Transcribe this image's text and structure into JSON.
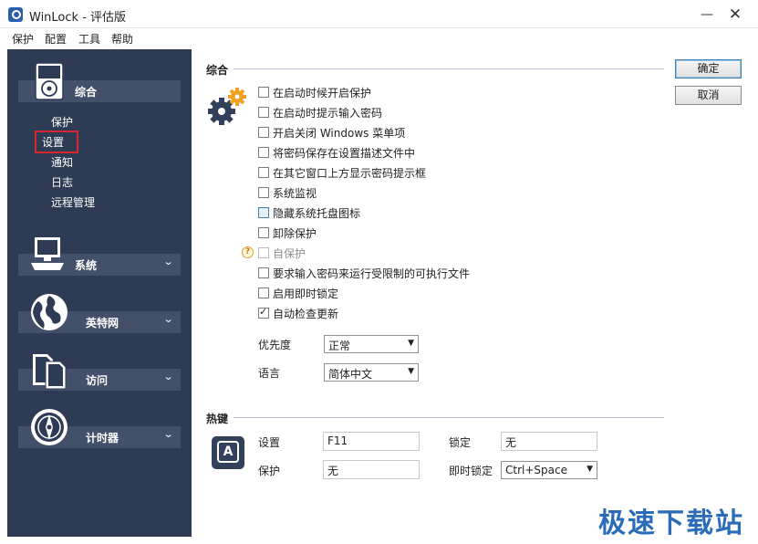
{
  "window": {
    "title": "WinLock - 评估版",
    "minimize": "—",
    "close": "✕"
  },
  "menu": [
    "保护",
    "配置",
    "工具",
    "帮助"
  ],
  "sidebar": {
    "categories": [
      {
        "label": "综合",
        "icon": "ipod-icon",
        "expanded": true,
        "items": [
          "保护",
          "设置",
          "通知",
          "日志",
          "远程管理"
        ],
        "selected": "设置"
      },
      {
        "label": "系统",
        "icon": "computer-icon",
        "chevron": "⌄"
      },
      {
        "label": "英特网",
        "icon": "globe-icon",
        "chevron": "⌄"
      },
      {
        "label": "访问",
        "icon": "documents-icon",
        "chevron": "⌄"
      },
      {
        "label": "计时器",
        "icon": "compass-icon",
        "chevron": "⌄"
      }
    ]
  },
  "general": {
    "title": "综合",
    "options": [
      {
        "label": "在启动时候开启保护",
        "checked": false
      },
      {
        "label": "在启动时提示输入密码",
        "checked": false
      },
      {
        "label": "开启关闭 Windows 菜单项",
        "checked": false
      },
      {
        "label": "将密码保存在设置描述文件中",
        "checked": false
      },
      {
        "label": "在其它窗口上方显示密码提示框",
        "checked": false
      },
      {
        "label": "系统监视",
        "checked": false
      },
      {
        "label": "隐藏系统托盘图标",
        "checked": false,
        "highlighted": true
      },
      {
        "label": "卸除保护",
        "checked": false
      },
      {
        "label": "自保护",
        "checked": false,
        "disabled": true
      },
      {
        "label": "要求输入密码来运行受限制的可执行文件",
        "checked": false
      },
      {
        "label": "启用即时锁定",
        "checked": false
      },
      {
        "label": "自动检查更新",
        "checked": true
      }
    ],
    "priority_label": "优先度",
    "priority_value": "正常",
    "language_label": "语言",
    "language_value": "简体中文"
  },
  "hotkeys": {
    "title": "热键",
    "icon_letter": "A",
    "settings_label": "设置",
    "settings_value": "F11",
    "protect_label": "保护",
    "protect_value": "无",
    "lock_label": "锁定",
    "lock_value": "无",
    "instant_lock_label": "即时锁定",
    "instant_lock_value": "Ctrl+Space"
  },
  "buttons": {
    "ok": "确定",
    "cancel": "取消"
  },
  "watermark": "极速下载站",
  "colors": {
    "sidebar": "#2d3b55",
    "category_bar": "#42506a",
    "selected_outline": "#d8262c",
    "gear_orange": "#f0a020",
    "watermark": "#2a6cb8"
  }
}
